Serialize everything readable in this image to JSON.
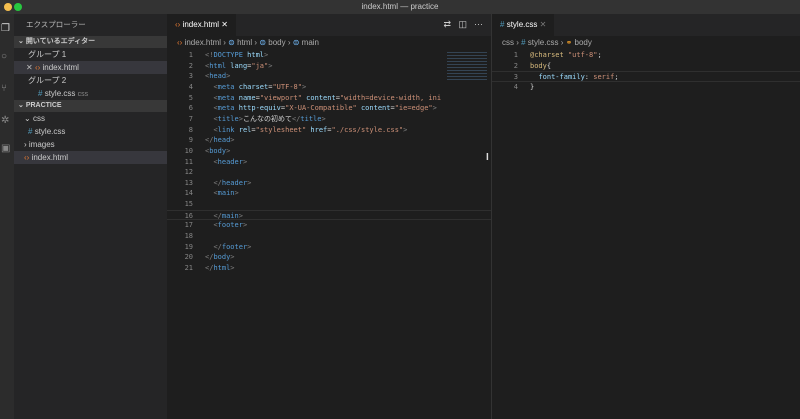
{
  "window": {
    "title": "index.html — practice"
  },
  "colors": {
    "close": "#e5534b",
    "min": "#f5bf4f",
    "max": "#28c840",
    "accent": "#569cd6"
  },
  "sidebar": {
    "title": "エクスプローラー",
    "open_editors": "開いているエディター",
    "group1": "グループ 1",
    "group1_file": "index.html",
    "group2": "グループ 2",
    "group2_file": "style.css",
    "group2_desc": "css",
    "project": "PRACTICE",
    "folder_css": "css",
    "file_style": "style.css",
    "folder_images": "images",
    "file_index": "index.html"
  },
  "editor1": {
    "tab": "index.html",
    "crumbs": [
      "index.html",
      "html",
      "body",
      "main"
    ],
    "lines": [
      [
        [
          "t-pun",
          "<!"
        ],
        [
          "t-tag",
          "DOCTYPE "
        ],
        [
          "t-attr",
          "html"
        ],
        [
          "t-pun",
          ">"
        ]
      ],
      [
        [
          "t-pun",
          "<"
        ],
        [
          "t-tag",
          "html "
        ],
        [
          "t-attr",
          "lang"
        ],
        [
          "t-txt",
          "="
        ],
        [
          "t-str",
          "\"ja\""
        ],
        [
          "t-pun",
          ">"
        ]
      ],
      [
        [
          "t-pun",
          "<"
        ],
        [
          "t-tag",
          "head"
        ],
        [
          "t-pun",
          ">"
        ]
      ],
      [
        [
          "t-txt",
          "  "
        ],
        [
          "t-pun",
          "<"
        ],
        [
          "t-tag",
          "meta "
        ],
        [
          "t-attr",
          "charset"
        ],
        [
          "t-txt",
          "="
        ],
        [
          "t-str",
          "\"UTF-8\""
        ],
        [
          "t-pun",
          ">"
        ]
      ],
      [
        [
          "t-txt",
          "  "
        ],
        [
          "t-pun",
          "<"
        ],
        [
          "t-tag",
          "meta "
        ],
        [
          "t-attr",
          "name"
        ],
        [
          "t-txt",
          "="
        ],
        [
          "t-str",
          "\"viewport\" "
        ],
        [
          "t-attr",
          "content"
        ],
        [
          "t-txt",
          "="
        ],
        [
          "t-str",
          "\"width=device-width, ini"
        ]
      ],
      [
        [
          "t-txt",
          "  "
        ],
        [
          "t-pun",
          "<"
        ],
        [
          "t-tag",
          "meta "
        ],
        [
          "t-attr",
          "http-equiv"
        ],
        [
          "t-txt",
          "="
        ],
        [
          "t-str",
          "\"X-UA-Compatible\" "
        ],
        [
          "t-attr",
          "content"
        ],
        [
          "t-txt",
          "="
        ],
        [
          "t-str",
          "\"ie=edge\""
        ],
        [
          "t-pun",
          ">"
        ]
      ],
      [
        [
          "t-txt",
          "  "
        ],
        [
          "t-pun",
          "<"
        ],
        [
          "t-tag",
          "title"
        ],
        [
          "t-pun",
          ">"
        ],
        [
          "t-txt",
          "こんなの初めて"
        ],
        [
          "t-pun",
          "</"
        ],
        [
          "t-tag",
          "title"
        ],
        [
          "t-pun",
          ">"
        ]
      ],
      [
        [
          "t-txt",
          "  "
        ],
        [
          "t-pun",
          "<"
        ],
        [
          "t-tag",
          "link "
        ],
        [
          "t-attr",
          "rel"
        ],
        [
          "t-txt",
          "="
        ],
        [
          "t-str",
          "\"stylesheet\" "
        ],
        [
          "t-attr",
          "href"
        ],
        [
          "t-txt",
          "="
        ],
        [
          "t-str",
          "\"./css/style.css\""
        ],
        [
          "t-pun",
          ">"
        ]
      ],
      [
        [
          "t-pun",
          "</"
        ],
        [
          "t-tag",
          "head"
        ],
        [
          "t-pun",
          ">"
        ]
      ],
      [
        [
          "t-pun",
          "<"
        ],
        [
          "t-tag",
          "body"
        ],
        [
          "t-pun",
          ">"
        ]
      ],
      [
        [
          "t-txt",
          "  "
        ],
        [
          "t-pun",
          "<"
        ],
        [
          "t-tag",
          "header"
        ],
        [
          "t-pun",
          ">"
        ]
      ],
      [],
      [
        [
          "t-txt",
          "  "
        ],
        [
          "t-pun",
          "</"
        ],
        [
          "t-tag",
          "header"
        ],
        [
          "t-pun",
          ">"
        ]
      ],
      [
        [
          "t-txt",
          "  "
        ],
        [
          "t-pun",
          "<"
        ],
        [
          "t-tag",
          "main"
        ],
        [
          "t-pun",
          ">"
        ]
      ],
      [],
      [
        [
          "t-txt",
          "  "
        ],
        [
          "t-pun",
          "</"
        ],
        [
          "t-tag",
          "main"
        ],
        [
          "t-pun",
          ">"
        ]
      ],
      [
        [
          "t-txt",
          "  "
        ],
        [
          "t-pun",
          "<"
        ],
        [
          "t-tag",
          "footer"
        ],
        [
          "t-pun",
          ">"
        ]
      ],
      [],
      [
        [
          "t-txt",
          "  "
        ],
        [
          "t-pun",
          "</"
        ],
        [
          "t-tag",
          "footer"
        ],
        [
          "t-pun",
          ">"
        ]
      ],
      [
        [
          "t-pun",
          "</"
        ],
        [
          "t-tag",
          "body"
        ],
        [
          "t-pun",
          ">"
        ]
      ],
      [
        [
          "t-pun",
          "</"
        ],
        [
          "t-tag",
          "html"
        ],
        [
          "t-pun",
          ">"
        ]
      ]
    ]
  },
  "editor2": {
    "tab": "style.css",
    "crumbs": [
      "css",
      "style.css",
      "body"
    ],
    "lines": [
      [
        [
          "t-sel",
          "@charset "
        ],
        [
          "t-str",
          "\"utf-8\""
        ],
        [
          "t-txt",
          ";"
        ]
      ],
      [
        [
          "t-sel",
          "body"
        ],
        [
          "t-txt",
          "{"
        ]
      ],
      [
        [
          "t-txt",
          "  "
        ],
        [
          "t-attr",
          "font-family"
        ],
        [
          "t-txt",
          ": "
        ],
        [
          "t-str",
          "serif"
        ],
        [
          "t-txt",
          ";"
        ]
      ],
      [
        [
          "t-txt",
          "}"
        ]
      ]
    ]
  }
}
